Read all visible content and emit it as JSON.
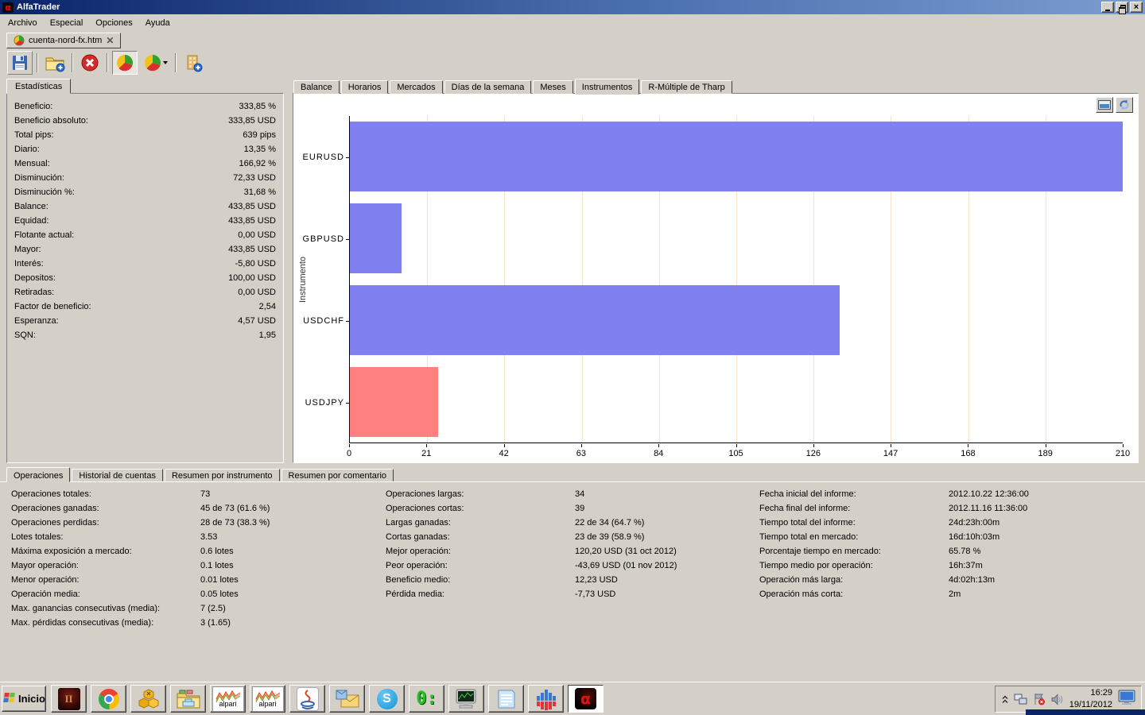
{
  "window": {
    "title": "AlfaTrader"
  },
  "menu": {
    "items": [
      "Archivo",
      "Especial",
      "Opciones",
      "Ayuda"
    ]
  },
  "document_tabs": {
    "active": "cuenta-nord-fx.htm"
  },
  "toolbar": {
    "buttons": [
      "save",
      "new-account",
      "stop",
      "pie-chart",
      "pie-chart-menu",
      "add-account"
    ]
  },
  "stats_panel": {
    "tab_label": "Estadísticas",
    "rows": [
      {
        "label": "Beneficio:",
        "value": "333,85 %"
      },
      {
        "label": "Beneficio absoluto:",
        "value": "333,85 USD"
      },
      {
        "label": "Total pips:",
        "value": "639 pips"
      },
      {
        "label": "Diario:",
        "value": "13,35 %"
      },
      {
        "label": "Mensual:",
        "value": "166,92 %"
      },
      {
        "label": "Disminución:",
        "value": "72,33 USD"
      },
      {
        "label": "Disminución %:",
        "value": "31,68 %"
      },
      {
        "label": "Balance:",
        "value": "433,85 USD"
      },
      {
        "label": "Equidad:",
        "value": "433,85 USD"
      },
      {
        "label": "Flotante actual:",
        "value": "0,00 USD"
      },
      {
        "label": "Mayor:",
        "value": "433,85 USD"
      },
      {
        "label": "Interés:",
        "value": "-5,80 USD"
      },
      {
        "label": "Depositos:",
        "value": "100,00 USD"
      },
      {
        "label": "Retiradas:",
        "value": "0,00 USD"
      },
      {
        "label": "Factor de beneficio:",
        "value": "2,54"
      },
      {
        "label": "Esperanza:",
        "value": "4,57 USD"
      },
      {
        "label": "SQN:",
        "value": "1,95"
      }
    ]
  },
  "chart_area": {
    "tabs": [
      "Balance",
      "Horarios",
      "Mercados",
      "Días de la semana",
      "Meses",
      "Instrumentos",
      "R-Múltiple de Tharp"
    ],
    "active_tab": "Instrumentos",
    "buttons": [
      "snapshot",
      "refresh"
    ]
  },
  "chart_data": {
    "type": "bar",
    "orientation": "horizontal",
    "categories": [
      "EURUSD",
      "GBPUSD",
      "USDCHF",
      "USDJPY"
    ],
    "values": [
      211,
      14,
      133,
      24
    ],
    "bar_colors": [
      "#8080f0",
      "#8080f0",
      "#8080f0",
      "#ff8080"
    ],
    "ylabel": "Instrumento",
    "xlabel": "",
    "xlim": [
      0,
      210
    ],
    "xticks": [
      0,
      21,
      42,
      63,
      84,
      105,
      126,
      147,
      168,
      189,
      210
    ],
    "grid": true,
    "grid_color": "#f2e4c4"
  },
  "operations_panel": {
    "tabs": [
      "Operaciones",
      "Historial de cuentas",
      "Resumen por instrumento",
      "Resumen por comentario"
    ],
    "active_tab": "Operaciones",
    "columns": [
      {
        "rows": [
          {
            "label": "Operaciones totales:",
            "value": "73"
          },
          {
            "label": "Operaciones ganadas:",
            "value": "45 de 73 (61.6 %)"
          },
          {
            "label": "Operaciones perdidas:",
            "value": "28 de 73 (38.3 %)"
          },
          {
            "label": "Lotes totales:",
            "value": "3.53"
          },
          {
            "label": "Máxima exposición a mercado:",
            "value": "0.6 lotes"
          },
          {
            "label": "Mayor operación:",
            "value": "0.1 lotes"
          },
          {
            "label": "Menor operación:",
            "value": "0.01 lotes"
          },
          {
            "label": "Operación media:",
            "value": "0.05 lotes"
          },
          {
            "label": "Max. ganancias consecutivas (media):",
            "value": "7 (2.5)"
          },
          {
            "label": "Max. pérdidas consecutivas (media):",
            "value": "3 (1.65)"
          }
        ]
      },
      {
        "rows": [
          {
            "label": "Operaciones largas:",
            "value": "34"
          },
          {
            "label": "Operaciones cortas:",
            "value": "39"
          },
          {
            "label": "Largas ganadas:",
            "value": "22 de 34 (64.7 %)"
          },
          {
            "label": "Cortas ganadas:",
            "value": "23 de 39 (58.9 %)"
          },
          {
            "label": "Mejor operación:",
            "value": "120,20 USD (31 oct 2012)"
          },
          {
            "label": "Peor operación:",
            "value": "-43,69 USD (01 nov 2012)"
          },
          {
            "label": "Beneficio medio:",
            "value": "12,23 USD"
          },
          {
            "label": "Pérdida media:",
            "value": "-7,73 USD"
          }
        ]
      },
      {
        "rows": [
          {
            "label": "Fecha inicial del informe:",
            "value": "2012.10.22 12:36:00"
          },
          {
            "label": "Fecha final del informe:",
            "value": "2012.11.16 11:36:00"
          },
          {
            "label": "Tiempo total del informe:",
            "value": "24d:23h:00m"
          },
          {
            "label": "Tiempo total en mercado:",
            "value": "16d:10h:03m"
          },
          {
            "label": "Porcentaje tiempo en mercado:",
            "value": "65.78 %"
          },
          {
            "label": "Tiempo medio por operación:",
            "value": "16h:37m"
          },
          {
            "label": "Operación más larga:",
            "value": "4d:02h:13m"
          },
          {
            "label": "Operación más corta:",
            "value": "2m"
          }
        ]
      }
    ]
  },
  "taskbar": {
    "start_label": "Inicio",
    "quick_launch": [
      "lineage-ii",
      "chrome",
      "game-tools",
      "file-explorer",
      "alpari-mt4",
      "alpari-mt4-2",
      "java",
      "outlook-express",
      "skype",
      "timer",
      "trading-terminal",
      "notepad",
      "volume-mixer",
      "alfatrader"
    ],
    "active_app": "alfatrader",
    "alpari_label": "alpari",
    "timer_label": "0:",
    "tray": {
      "icons": [
        "collapse-chevron",
        "network",
        "security-alert",
        "volume"
      ],
      "time": "16:29",
      "date": "19/11/2012"
    }
  },
  "colors": {
    "bar_blue": "#8080f0",
    "bar_red": "#ff8080",
    "grid": "#f2e4c4",
    "titlebar_left": "#0a246a",
    "titlebar_right": "#7b9cd0"
  }
}
